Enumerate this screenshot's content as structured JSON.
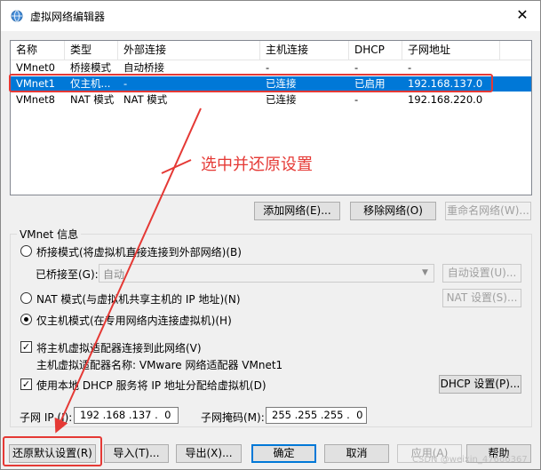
{
  "window": {
    "title": "虚拟网络编辑器",
    "close_glyph": "✕"
  },
  "network_list": {
    "columns": [
      "名称",
      "类型",
      "外部连接",
      "主机连接",
      "DHCP",
      "子网地址"
    ],
    "rows": [
      {
        "name": "VMnet0",
        "type": "桥接模式",
        "external": "自动桥接",
        "host": "-",
        "dhcp": "-",
        "subnet": "-",
        "selected": false
      },
      {
        "name": "VMnet1",
        "type": "仅主机...",
        "external": "-",
        "host": "已连接",
        "dhcp": "已启用",
        "subnet": "192.168.137.0",
        "selected": true
      },
      {
        "name": "VMnet8",
        "type": "NAT 模式",
        "external": "NAT 模式",
        "host": "已连接",
        "dhcp": "-",
        "subnet": "192.168.220.0",
        "selected": false
      }
    ]
  },
  "list_buttons": {
    "add": "添加网络(E)...",
    "remove": "移除网络(O)",
    "rename": "重命名网络(W)..."
  },
  "vmnet_info": {
    "group_label": "VMnet 信息",
    "bridged_label": "桥接模式(将虚拟机直接连接到外部网络)(B)",
    "bridged_to_label": "已桥接至(G):",
    "bridged_to_value": "自动",
    "auto_settings": "自动设置(U)...",
    "nat_label": "NAT 模式(与虚拟机共享主机的 IP 地址)(N)",
    "nat_settings": "NAT 设置(S)...",
    "hostonly_label": "仅主机模式(在专用网络内连接虚拟机)(H)",
    "connect_adapter_label": "将主机虚拟适配器连接到此网络(V)",
    "adapter_name_label": "主机虚拟适配器名称: VMware 网络适配器 VMnet1",
    "use_dhcp_label": "使用本地 DHCP 服务将 IP 地址分配给虚拟机(D)",
    "dhcp_settings": "DHCP 设置(P)...",
    "subnet_ip_label": "子网 IP (I):",
    "subnet_ip_value": "192 .168 .137 .  0",
    "subnet_mask_label": "子网掩码(M):",
    "subnet_mask_value": "255 .255 .255 .  0",
    "mode": "hostonly",
    "connect_adapter_checked": true,
    "use_dhcp_checked": true
  },
  "bottom_buttons": {
    "restore": "还原默认设置(R)",
    "import": "导入(T)...",
    "export": "导出(X)...",
    "ok": "确定",
    "cancel": "取消",
    "apply": "应用(A)",
    "help": "帮助"
  },
  "annotation": {
    "text": "选中并还原设置",
    "color": "#e53935"
  },
  "watermark": "CSDN @weixin_47666367",
  "colors": {
    "selection": "#0078d7",
    "annotation_red": "#e53935"
  }
}
